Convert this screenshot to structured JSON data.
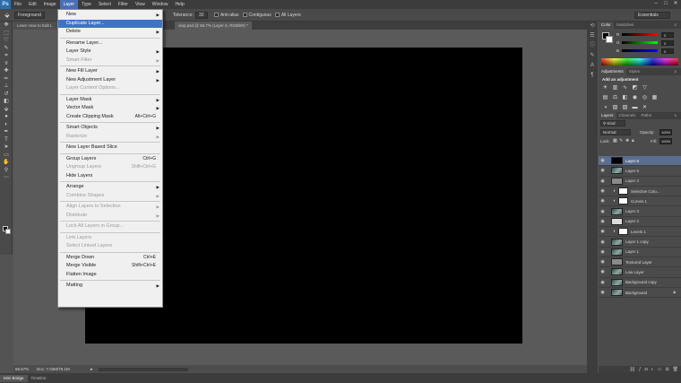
{
  "menubar": {
    "logo": "Ps",
    "items": [
      "File",
      "Edit",
      "Image",
      "Layer",
      "Type",
      "Select",
      "Filter",
      "View",
      "Window",
      "Help"
    ],
    "active_index": 3
  },
  "options": {
    "fill_source": "Foreground",
    "tolerance_label": "Tolerance:",
    "tolerance_value": "32",
    "anti_alias": "Anti-alias",
    "contiguous": "Contiguous",
    "all_layers": "All Layers",
    "workspace": "Essentials"
  },
  "document": {
    "tab1": "Learn How to Edit L",
    "tab2": "olop.psd @ 66.7% (Layer 6, RGB/8#) *",
    "zoom": "66.67%",
    "doc_info": "Doc: 7.03M/79.1M"
  },
  "bottom_tabs": [
    "Mini Bridge",
    "Timeline"
  ],
  "layer_menu": {
    "items": [
      {
        "label": "New",
        "submenu": true
      },
      {
        "label": "Duplicate Layer...",
        "highlight": true
      },
      {
        "label": "Delete",
        "submenu": true
      },
      {
        "sep": true
      },
      {
        "label": "Rename Layer..."
      },
      {
        "label": "Layer Style",
        "submenu": true
      },
      {
        "label": "Smart Filter",
        "disabled": true,
        "submenu": true
      },
      {
        "sep": true
      },
      {
        "label": "New Fill Layer",
        "submenu": true
      },
      {
        "label": "New Adjustment Layer",
        "submenu": true
      },
      {
        "label": "Layer Content Options...",
        "disabled": true
      },
      {
        "sep": true
      },
      {
        "label": "Layer Mask",
        "submenu": true
      },
      {
        "label": "Vector Mask",
        "submenu": true
      },
      {
        "label": "Create Clipping Mask",
        "shortcut": "Alt+Ctrl+G"
      },
      {
        "sep": true
      },
      {
        "label": "Smart Objects",
        "submenu": true
      },
      {
        "label": "Rasterize",
        "disabled": true,
        "submenu": true
      },
      {
        "sep": true
      },
      {
        "label": "New Layer Based Slice"
      },
      {
        "sep": true
      },
      {
        "label": "Group Layers",
        "shortcut": "Ctrl+G"
      },
      {
        "label": "Ungroup Layers",
        "shortcut": "Shift+Ctrl+G",
        "disabled": true
      },
      {
        "label": "Hide Layers"
      },
      {
        "sep": true
      },
      {
        "label": "Arrange",
        "submenu": true
      },
      {
        "label": "Combine Shapes",
        "disabled": true,
        "submenu": true
      },
      {
        "sep": true
      },
      {
        "label": "Align Layers to Selection",
        "disabled": true,
        "submenu": true
      },
      {
        "label": "Distribute",
        "disabled": true,
        "submenu": true
      },
      {
        "sep": true
      },
      {
        "label": "Lock All Layers in Group...",
        "disabled": true
      },
      {
        "sep": true
      },
      {
        "label": "Link Layers",
        "disabled": true
      },
      {
        "label": "Select Linked Layers",
        "disabled": true
      },
      {
        "sep": true
      },
      {
        "label": "Merge Down",
        "shortcut": "Ctrl+E"
      },
      {
        "label": "Merge Visible",
        "shortcut": "Shift+Ctrl+E"
      },
      {
        "label": "Flatten Image"
      },
      {
        "sep": true
      },
      {
        "label": "Matting",
        "submenu": true
      }
    ]
  },
  "color_panel": {
    "tabs": [
      "Color",
      "Swatches"
    ],
    "channels": [
      {
        "name": "R",
        "value": "0",
        "gradient": "linear-gradient(to right,#000,#f00)"
      },
      {
        "name": "G",
        "value": "0",
        "gradient": "linear-gradient(to right,#000,#0f0)"
      },
      {
        "name": "B",
        "value": "0",
        "gradient": "linear-gradient(to right,#000,#00f)"
      }
    ]
  },
  "adjustments_panel": {
    "tabs": [
      "Adjustments",
      "Styles"
    ],
    "title": "Add an adjustment"
  },
  "layers_panel": {
    "tabs": [
      "Layers",
      "Channels",
      "Paths"
    ],
    "kind": "Kind",
    "blend_mode": "Normal",
    "opacity_label": "Opacity:",
    "opacity_value": "100%",
    "lock_label": "Lock:",
    "fill_label": "Fill:",
    "fill_value": "100%",
    "layers": [
      {
        "name": "Layer 6",
        "thumb": "th-black",
        "selected": true
      },
      {
        "name": "Layer 5",
        "thumb": "th-img"
      },
      {
        "name": "Layer 4",
        "thumb": "th-gray"
      },
      {
        "name": "Selective Colo...",
        "adjustment": true
      },
      {
        "name": "Curves 1",
        "adjustment": true
      },
      {
        "name": "Layer 3",
        "thumb": "th-img"
      },
      {
        "name": "Layer 2",
        "thumb": "th-white"
      },
      {
        "name": "Levels 1",
        "adjustment": true
      },
      {
        "name": "Layer 1 copy",
        "thumb": "th-img"
      },
      {
        "name": "Layer 1",
        "thumb": "th-img"
      },
      {
        "name": "Textured Layer",
        "thumb": "th-gray"
      },
      {
        "name": "Low Layer",
        "thumb": "th-img"
      },
      {
        "name": "Background copy",
        "thumb": "th-img"
      },
      {
        "name": "Background",
        "thumb": "th-img",
        "locked": true
      }
    ]
  },
  "colors": {
    "menu_highlight": "#3f73c8",
    "selected_layer": "#5b6e8f",
    "canvas": "#000000"
  }
}
